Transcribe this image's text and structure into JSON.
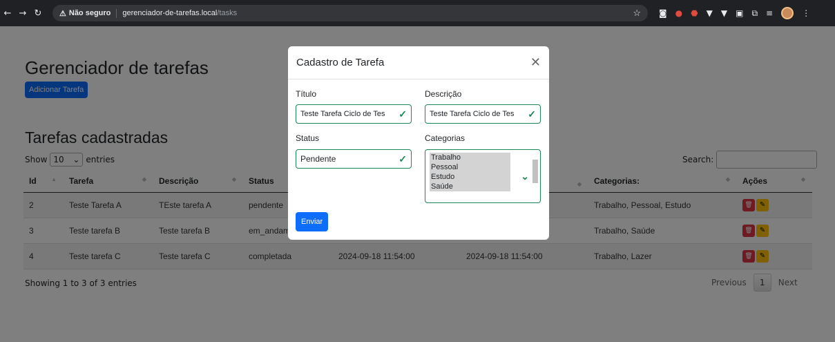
{
  "browser": {
    "not_secure": "Não seguro",
    "url_host": "gerenciador-de-tarefas.local",
    "url_path": "/tasks"
  },
  "page": {
    "title": "Gerenciador de tarefas",
    "add_button": "Adicionar Tarefa",
    "list_title": "Tarefas cadastradas",
    "show_label": "Show",
    "entries_value": "10",
    "entries_label": "entries",
    "search_label": "Search:",
    "columns": [
      "Id",
      "Tarefa",
      "Descrição",
      "Status",
      "",
      "",
      "Categorias:",
      "Ações"
    ],
    "rows": [
      [
        "2",
        "Teste Tarefa A",
        "TEste tarefa A",
        "pendente",
        "",
        "",
        "Trabalho, Pessoal, Estudo"
      ],
      [
        "3",
        "Teste tarefa B",
        "Teste tarefa B",
        "em_andam",
        "",
        "",
        "Trabalho, Saúde"
      ],
      [
        "4",
        "Teste tarefa C",
        "Teste tarefa C",
        "completada",
        "2024-09-18 11:54:00",
        "2024-09-18 11:54:00",
        "Trabalho, Lazer"
      ]
    ],
    "info": "Showing 1 to 3 of 3 entries",
    "prev": "Previous",
    "page_num": "1",
    "next": "Next"
  },
  "modal": {
    "title": "Cadastro de Tarefa",
    "titulo_label": "Título",
    "titulo_value": "Teste Tarefa Ciclo de Tes",
    "descricao_label": "Descrição",
    "descricao_value": "Teste Tarefa Ciclo de Tes",
    "status_label": "Status",
    "status_value": "Pendente",
    "categorias_label": "Categorias",
    "categorias_options": [
      "Trabalho",
      "Pessoal",
      "Estudo",
      "Saúde"
    ],
    "submit": "Enviar"
  },
  "colors": {
    "primary": "#0d6efd",
    "valid": "#198754",
    "danger": "#dc3545",
    "warning": "#ffc107"
  }
}
